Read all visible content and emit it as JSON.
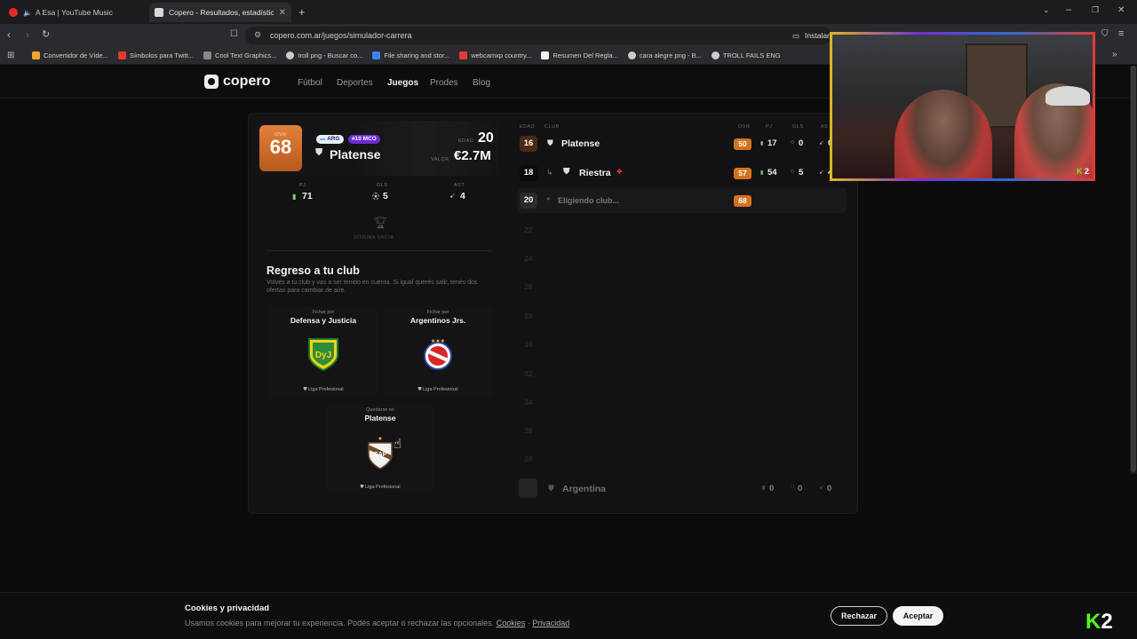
{
  "browser": {
    "tabs": [
      {
        "title": "A Esa | YouTube Music",
        "favicon_color": "#e22b2b"
      },
      {
        "title": "Copero - Resultados, estadística",
        "favicon_color": "#d9d9d9"
      }
    ],
    "new_tab": "+",
    "url": "copero.com.ar/juegos/simulador-carrera",
    "install_label": "Instalar",
    "bookmarks": [
      {
        "label": "Convertidor de Víde...",
        "color": "#f0a62b"
      },
      {
        "label": "Símbolos para Twitt...",
        "color": "#e53935"
      },
      {
        "label": "Cool Text Graphics...",
        "color": "#888888"
      },
      {
        "label": "troll png - Buscar co...",
        "color": "#cccccc"
      },
      {
        "label": "File sharing and stor...",
        "color": "#3b82f6"
      },
      {
        "label": "webcamxp country...",
        "color": "#e53935"
      },
      {
        "label": "Resumen Del Regla...",
        "color": "#f2f2f2"
      },
      {
        "label": "cara alegre png - B...",
        "color": "#cccccc"
      },
      {
        "label": "TROLL FAILS ENG",
        "color": "#cccccc"
      }
    ]
  },
  "site": {
    "logo": "copero",
    "nav": [
      "Fútbol",
      "Deportes",
      "Juegos",
      "Prodes",
      "Blog"
    ],
    "active_nav": "Juegos"
  },
  "player": {
    "ovr_label": "OVR",
    "ovr": "68",
    "country": "ARG",
    "position": "#10 MCO",
    "club": "Platense",
    "age_label": "EDAD",
    "age": "20",
    "value_label": "VALOR",
    "value": "€2.7M",
    "stats": [
      {
        "label": "PJ",
        "value": "71"
      },
      {
        "label": "GLS",
        "value": "5"
      },
      {
        "label": "AST",
        "value": "4"
      }
    ],
    "trophy_label": "VITRINA VACÍA"
  },
  "decision": {
    "title": "Regreso a tu club",
    "description": "Volvés a tu club y vas a ser tenido en cuenta. Si igual querés salir, tenés dos ofertas para cambiar de aire.",
    "offers": [
      {
        "prefix": "Fichar por",
        "club": "Defensa y Justicia",
        "league": "Liga Profesional",
        "crest_text": "DyJ"
      },
      {
        "prefix": "Fichar por",
        "club": "Argentinos Jrs.",
        "league": "Liga Profesional",
        "crest_text": ""
      }
    ],
    "stay": {
      "prefix": "Quedarse en",
      "club": "Platense",
      "league": "Liga Profesional",
      "crest_text": "CAP"
    }
  },
  "career_table": {
    "headers": [
      "EDAD",
      "CLUB",
      "OVR",
      "PJ",
      "GLS",
      "AS"
    ],
    "rows": [
      {
        "age": "16",
        "club": "Platense",
        "ovr": "50",
        "pj": "17",
        "gls": "0",
        "ast": "0"
      },
      {
        "age": "18",
        "club": "Riestra",
        "ovr": "57",
        "pj": "54",
        "gls": "5",
        "ast": "4"
      },
      {
        "age": "20",
        "club": "Eligiendo club...",
        "ovr": "68"
      }
    ],
    "future_ages": [
      "22",
      "24",
      "26",
      "28",
      "30",
      "32",
      "34",
      "36",
      "38"
    ],
    "national_team": {
      "name": "Argentina",
      "pj": "0",
      "gls": "0",
      "ast": "0"
    }
  },
  "webcam": {
    "badge": "2"
  },
  "cookies": {
    "title": "Cookies y privacidad",
    "text": "Usamos cookies para mejorar tu experiencia. Podés aceptar o rechazar las opcionales.",
    "link_cookies": "Cookies",
    "separator": "·",
    "link_privacy": "Privacidad",
    "reject": "Rechazar",
    "accept": "Aceptar"
  },
  "kick_badge": "2",
  "colors": {
    "accent_orange": "#d5721f",
    "position_purple": "#6b2bd6",
    "kick_green": "#53fc18"
  }
}
